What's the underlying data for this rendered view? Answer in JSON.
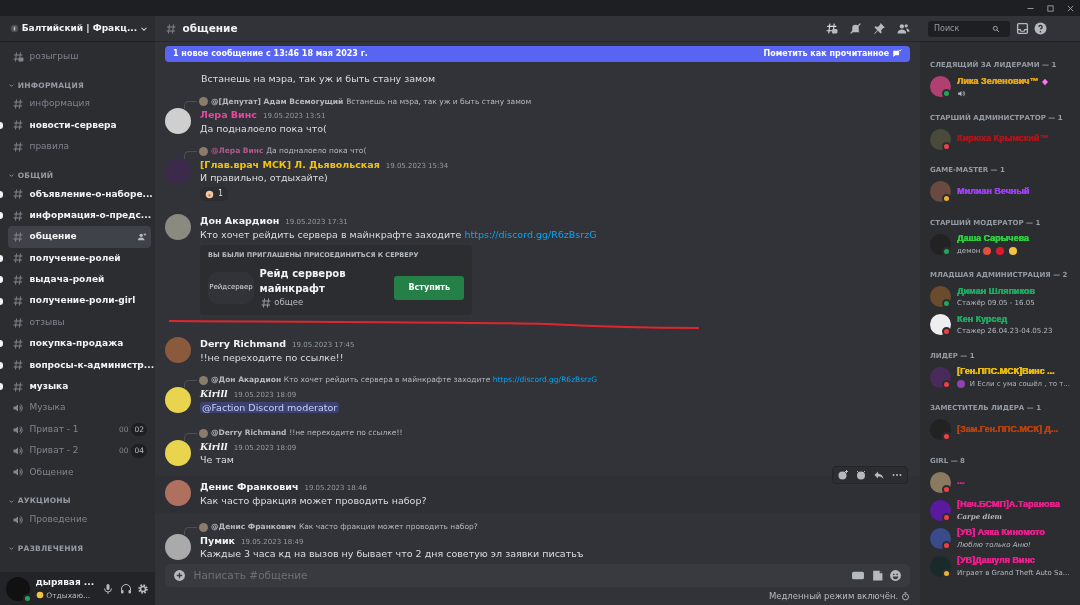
{
  "server": {
    "name": "Балтийский | Фракц..."
  },
  "sidebar": {
    "items": [
      {
        "kind": "forum",
        "label": "розыгрыш",
        "unread": false,
        "selected": false
      },
      {
        "kind": "category",
        "label": "ИНФОРМАЦИЯ"
      },
      {
        "kind": "text",
        "label": "информация",
        "unread": false,
        "selected": false
      },
      {
        "kind": "text",
        "label": "новости-сервера",
        "unread": true,
        "selected": false
      },
      {
        "kind": "text",
        "label": "правила",
        "unread": false,
        "selected": false
      },
      {
        "kind": "category",
        "label": "ОБЩИЙ"
      },
      {
        "kind": "text",
        "label": "объявление-о-наборе...",
        "unread": true,
        "selected": false
      },
      {
        "kind": "text",
        "label": "информация-о-предс...",
        "unread": true,
        "selected": false
      },
      {
        "kind": "text",
        "label": "общение",
        "unread": false,
        "selected": true
      },
      {
        "kind": "text",
        "label": "получение-ролей",
        "unread": true,
        "selected": false
      },
      {
        "kind": "text",
        "label": "выдача-ролей",
        "unread": true,
        "selected": false
      },
      {
        "kind": "text",
        "label": "получение-роли-girl",
        "unread": true,
        "selected": false
      },
      {
        "kind": "text",
        "label": "отзывы",
        "unread": false,
        "selected": false
      },
      {
        "kind": "text",
        "label": "покупка-продажа",
        "unread": true,
        "selected": false
      },
      {
        "kind": "text",
        "label": "вопросы-к-администр...",
        "unread": true,
        "selected": false
      },
      {
        "kind": "text",
        "label": "музыка",
        "unread": true,
        "selected": false
      },
      {
        "kind": "voice",
        "label": "Музыка",
        "unread": false,
        "selected": false
      },
      {
        "kind": "voice",
        "label": "Приват - 1",
        "unread": false,
        "selected": false,
        "counts": [
          "00",
          "02"
        ]
      },
      {
        "kind": "voice",
        "label": "Приват - 2",
        "unread": false,
        "selected": false,
        "counts": [
          "00",
          "04"
        ]
      },
      {
        "kind": "voice",
        "label": "Общение",
        "unread": false,
        "selected": false
      },
      {
        "kind": "category",
        "label": "АУКЦИОНЫ"
      },
      {
        "kind": "voice",
        "label": "Проведение",
        "unread": false,
        "selected": false
      },
      {
        "kind": "category",
        "label": "РАЗВЛЕЧЕНИЯ"
      }
    ]
  },
  "user_panel": {
    "name": "дырявая ...",
    "status": "Отдыхаю..."
  },
  "chat": {
    "channel": "общение",
    "banner": {
      "text": "1 новое сообщение с 13:46 18 мая 2023 г.",
      "action": "Пометить как прочитанное"
    },
    "messages": [
      {
        "kind": "continuation",
        "text": "Встанешь на мэра, так уж и быть стану замом",
        "hovered": false
      },
      {
        "kind": "message",
        "hovered": false,
        "reply": {
          "author": "@[Депутат] Адам Всемогущий",
          "text": "Встанешь на мэра, так уж и быть стану замом"
        },
        "author": "Лера Винс",
        "color": "#eb459e",
        "time": "19.05.2023 13:51",
        "text": "Да подналоело пока что("
      },
      {
        "kind": "message",
        "hovered": false,
        "reply": {
          "author": "@Лера Винс",
          "text": "Да подналоело пока что(",
          "color": "#b05a8c"
        },
        "author": "[Глав.врач МСК] Л. Дьявольская",
        "color": "#f1c40f",
        "time": "19.05.2023 15:34",
        "text": "И правильно, отдыхайте)",
        "reaction": {
          "count": "1"
        }
      },
      {
        "kind": "message",
        "hovered": false,
        "author": "Дон Акардион",
        "color": "#f2f3f5",
        "time": "19.05.2023 17:31",
        "text": "Кто хочет рейдить сервера в майнкрафте заходите ",
        "link": "https://discord.gg/R6zBsrzG",
        "invite": {
          "heading": "ВЫ БЫЛИ ПРИГЛАШЕНЫ ПРИСОЕДИНИТЬСЯ К СЕРВЕРУ",
          "icon_text": "Рейдсервер",
          "name": "Рейд серверов майнкрафт",
          "channel": "общее",
          "button": "Вступить"
        }
      },
      {
        "kind": "message",
        "hovered": false,
        "author": "Derry Richmand",
        "color": "#f2f3f5",
        "time": "19.05.2023 17:45",
        "text": "!!не переходите по ссылке!!"
      },
      {
        "kind": "message",
        "hovered": false,
        "reply": {
          "author": "@Дон Акардион",
          "text": "Кто хочет рейдить сервера в майнкрафте заходите ",
          "link": "https://discord.gg/R6zBsrzG"
        },
        "author": "Kirill",
        "color": "#f2f3f5",
        "time": "19.05.2023 18:09",
        "mention": "@Faction Discord moderator"
      },
      {
        "kind": "message",
        "hovered": false,
        "reply": {
          "author": "@Derry Richmand",
          "text": "!!не переходите по ссылке!!"
        },
        "author": "Kirill",
        "color": "#f2f3f5",
        "time": "19.05.2023 18:09",
        "text": "Че там"
      },
      {
        "kind": "message",
        "hovered": true,
        "author": "Денис Франкович",
        "color": "#f2f3f5",
        "time": "19.05.2023 18:46",
        "text": "Как часто фракция может проводить набор?"
      },
      {
        "kind": "message",
        "hovered": false,
        "reply": {
          "author": "@Денис Франкович",
          "text": "Как часто фракция может проводить набор?"
        },
        "author": "Пумик",
        "color": "#f2f3f5",
        "time": "19.05.2023 18:49",
        "text": "Каждые 3 часа кд на вызов ну бывает что 2 дня советую эл заявки писатьъ"
      }
    ],
    "composer": {
      "placeholder": "Написать #общение"
    },
    "slowmode": "Медленный режим включён."
  },
  "search": {
    "placeholder": "Поиск"
  },
  "members": {
    "groups": [
      {
        "title": "СЛЕДЯЩИЙ ЗА ЛИДЕРАМИ — 1",
        "members": [
          {
            "name": "Лика Зеленович™",
            "color": "#e0a21a",
            "kind": "online",
            "badge": true,
            "activity": [
              {
                "kind": "speaker"
              }
            ]
          }
        ]
      },
      {
        "title": "СТАРШИЙ АДМИНИСТРАТОР — 1",
        "members": [
          {
            "name": "Кирюха Крымский™",
            "color": "#a8171c",
            "kind": "dnd",
            "badge": false
          }
        ]
      },
      {
        "title": "GAME-MASTER — 1",
        "members": [
          {
            "name": "Милиан Вечный",
            "color": "#9b3ff0",
            "kind": "idle",
            "badge": false
          }
        ]
      },
      {
        "title": "СТАРШИЙ МОДЕРАТОР — 1",
        "members": [
          {
            "name": "Даша Сарычева",
            "color": "#2ecc40",
            "kind": "online",
            "badge": false,
            "activity": [
              {
                "kind": "text",
                "text": "демон"
              },
              {
                "kind": "emoji",
                "color": "#e74c3c"
              },
              {
                "kind": "emoji",
                "color": "#e0182d"
              },
              {
                "kind": "emoji",
                "color": "#f5c242"
              }
            ]
          }
        ]
      },
      {
        "title": "МЛАДШАЯ АДМИНИСТРАЦИЯ — 2",
        "members": [
          {
            "name": "Диман Шляпиков",
            "color": "#1fa862",
            "kind": "online",
            "badge": false,
            "activity": [
              {
                "kind": "text",
                "text": "Стажёр 09.05 - 16.05"
              }
            ]
          },
          {
            "name": "Кен Курсед",
            "color": "#1fa862",
            "kind": "dnd",
            "badge": false,
            "activity": [
              {
                "kind": "text",
                "text": "Стажер 26.04.23-04.05.23"
              }
            ]
          }
        ]
      },
      {
        "title": "ЛИДЕР — 1",
        "members": [
          {
            "name": "[Ген.ППС.МСК]Винс ...",
            "color": "#e8b90f",
            "kind": "dnd",
            "badge": false,
            "activity": [
              {
                "kind": "emoji",
                "color": "#8e44ad"
              },
              {
                "kind": "text",
                "text": "И Если с ума сошёл , то т..."
              }
            ]
          }
        ]
      },
      {
        "title": "ЗАМЕСТИТЕЛЬ ЛИДЕРА — 1",
        "members": [
          {
            "name": "[Зам.Ген.ППС.МСК] Д...",
            "color": "#b5410f",
            "kind": "dnd",
            "badge": false
          }
        ]
      },
      {
        "title": "GIRL — 8",
        "members": [
          {
            "name": "...",
            "color": "#e91e8c",
            "kind": "dnd",
            "badge": false
          },
          {
            "name": "[Нач.БСМП]А.Таранова",
            "color": "#e91e8c",
            "kind": "dnd",
            "badge": false,
            "activity": [
              {
                "kind": "fancy",
                "text": "Carpe diem"
              }
            ]
          },
          {
            "name": "[УВ] Аяка Киномото",
            "color": "#e91e8c",
            "kind": "dnd",
            "badge": false,
            "activity": [
              {
                "kind": "italic",
                "text": "Люблю только Аню!"
              }
            ]
          },
          {
            "name": "[УВ]Дашуля Винс",
            "color": "#e91e8c",
            "kind": "idle",
            "badge": false,
            "activity": [
              {
                "kind": "text",
                "text": "Играет в Grand Theft Auto Sa..."
              }
            ]
          }
        ]
      }
    ]
  }
}
